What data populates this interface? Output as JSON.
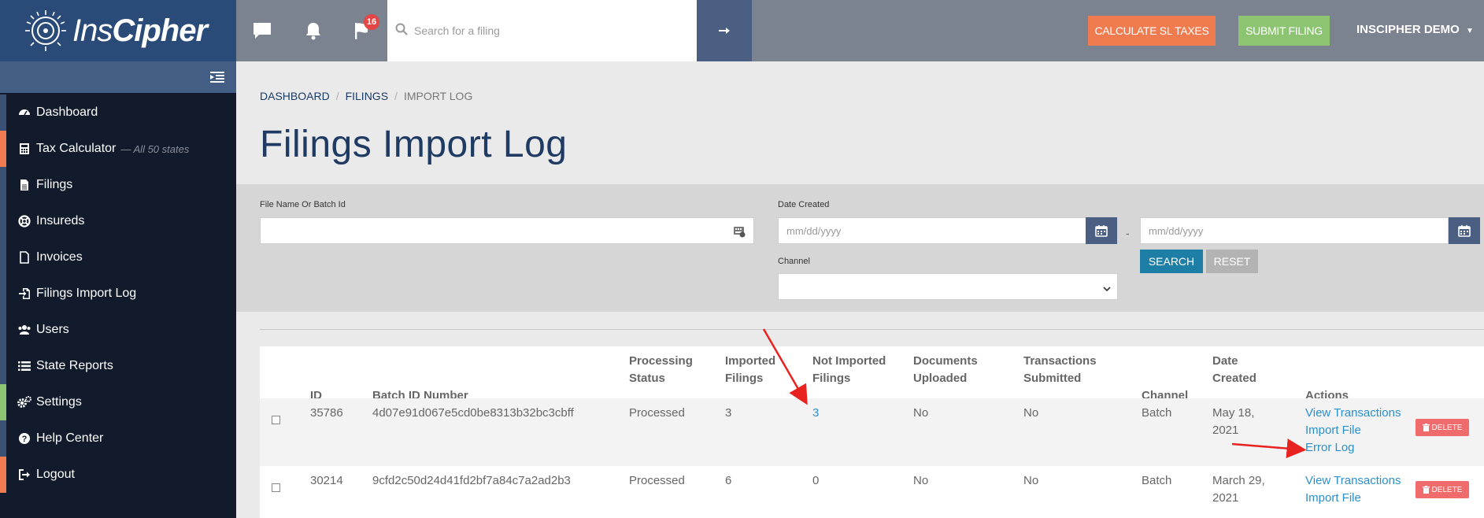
{
  "app": {
    "brand_light": "Ins",
    "brand_bold": "Cipher"
  },
  "sidebar": {
    "items": [
      {
        "label": "Dashboard",
        "icon": "dashboard-icon",
        "stripe": "#3a5175"
      },
      {
        "label": "Tax Calculator",
        "note": "— All 50 states",
        "icon": "calculator-icon",
        "stripe": "#f07b4f"
      },
      {
        "label": "Filings",
        "icon": "file-icon",
        "stripe": "#3a5175"
      },
      {
        "label": "Insureds",
        "icon": "life-ring-icon",
        "stripe": "#3a5175"
      },
      {
        "label": "Invoices",
        "icon": "document-icon",
        "stripe": "#3a5175"
      },
      {
        "label": "Filings Import Log",
        "icon": "import-icon",
        "stripe": "#3a5175"
      },
      {
        "label": "Users",
        "icon": "users-icon",
        "stripe": "#3a5175"
      },
      {
        "label": "State Reports",
        "icon": "list-icon",
        "stripe": "#3a5175"
      },
      {
        "label": "Settings",
        "icon": "gears-icon",
        "stripe": "#8cc471"
      },
      {
        "label": "Help Center",
        "icon": "question-icon",
        "stripe": "#3a5175"
      },
      {
        "label": "Logout",
        "icon": "logout-icon",
        "stripe": "#f07b4f"
      }
    ]
  },
  "topbar": {
    "notifications_count": "16",
    "search_placeholder": "Search for a filing",
    "calc_button": "CALCULATE SL TAXES",
    "submit_button": "SUBMIT FILING",
    "user_menu": "INSCIPHER DEMO"
  },
  "breadcrumb": {
    "items": [
      "DASHBOARD",
      "FILINGS"
    ],
    "current": "IMPORT LOG"
  },
  "page": {
    "title": "Filings Import Log"
  },
  "filters": {
    "file_name_label": "File Name Or Batch Id",
    "date_created_label": "Date Created",
    "date_from_placeholder": "mm/dd/yyyy",
    "date_separator": "-",
    "date_to_placeholder": "mm/dd/yyyy",
    "channel_label": "Channel",
    "channel_value": "",
    "search_button": "SEARCH",
    "reset_button": "RESET"
  },
  "table": {
    "headers": {
      "id": "ID",
      "batch": "Batch ID Number",
      "status_1": "Processing",
      "status_2": "Status",
      "imported_1": "Imported",
      "imported_2": "Filings",
      "not_imported_1": "Not Imported",
      "not_imported_2": "Filings",
      "documents_1": "Documents",
      "documents_2": "Uploaded",
      "transactions_1": "Transactions",
      "transactions_2": "Submitted",
      "channel": "Channel",
      "date_1": "Date",
      "date_2": "Created",
      "actions": "Actions"
    },
    "rows": [
      {
        "id": "35786",
        "batch": "4d07e91d067e5cd0be8313b32bc3cbff",
        "status": "Processed",
        "imported": "3",
        "not_imported": "3",
        "documents": "No",
        "transactions": "No",
        "channel": "Batch",
        "date_1": "May 18,",
        "date_2": "2021",
        "actions": [
          "View Transactions",
          "Import File",
          "Error Log"
        ],
        "delete": "DELETE"
      },
      {
        "id": "30214",
        "batch": "9cfd2c50d24d41fd2bf7a84c7a2ad2b3",
        "status": "Processed",
        "imported": "6",
        "not_imported": "0",
        "documents": "No",
        "transactions": "No",
        "channel": "Batch",
        "date_1": "March 29,",
        "date_2": "2021",
        "actions": [
          "View Transactions",
          "Import File"
        ],
        "delete": "DELETE"
      }
    ]
  },
  "colors": {
    "sidebar_bg": "#121b2c",
    "logo_bg": "#2a4a78",
    "title": "#1f3a63",
    "accent_orange": "#f07b4f",
    "accent_green": "#8cc471",
    "search_button": "#1e7fa6",
    "link": "#2b8fce",
    "delete": "#f06c6c",
    "annotation_arrow": "#e8221f"
  }
}
